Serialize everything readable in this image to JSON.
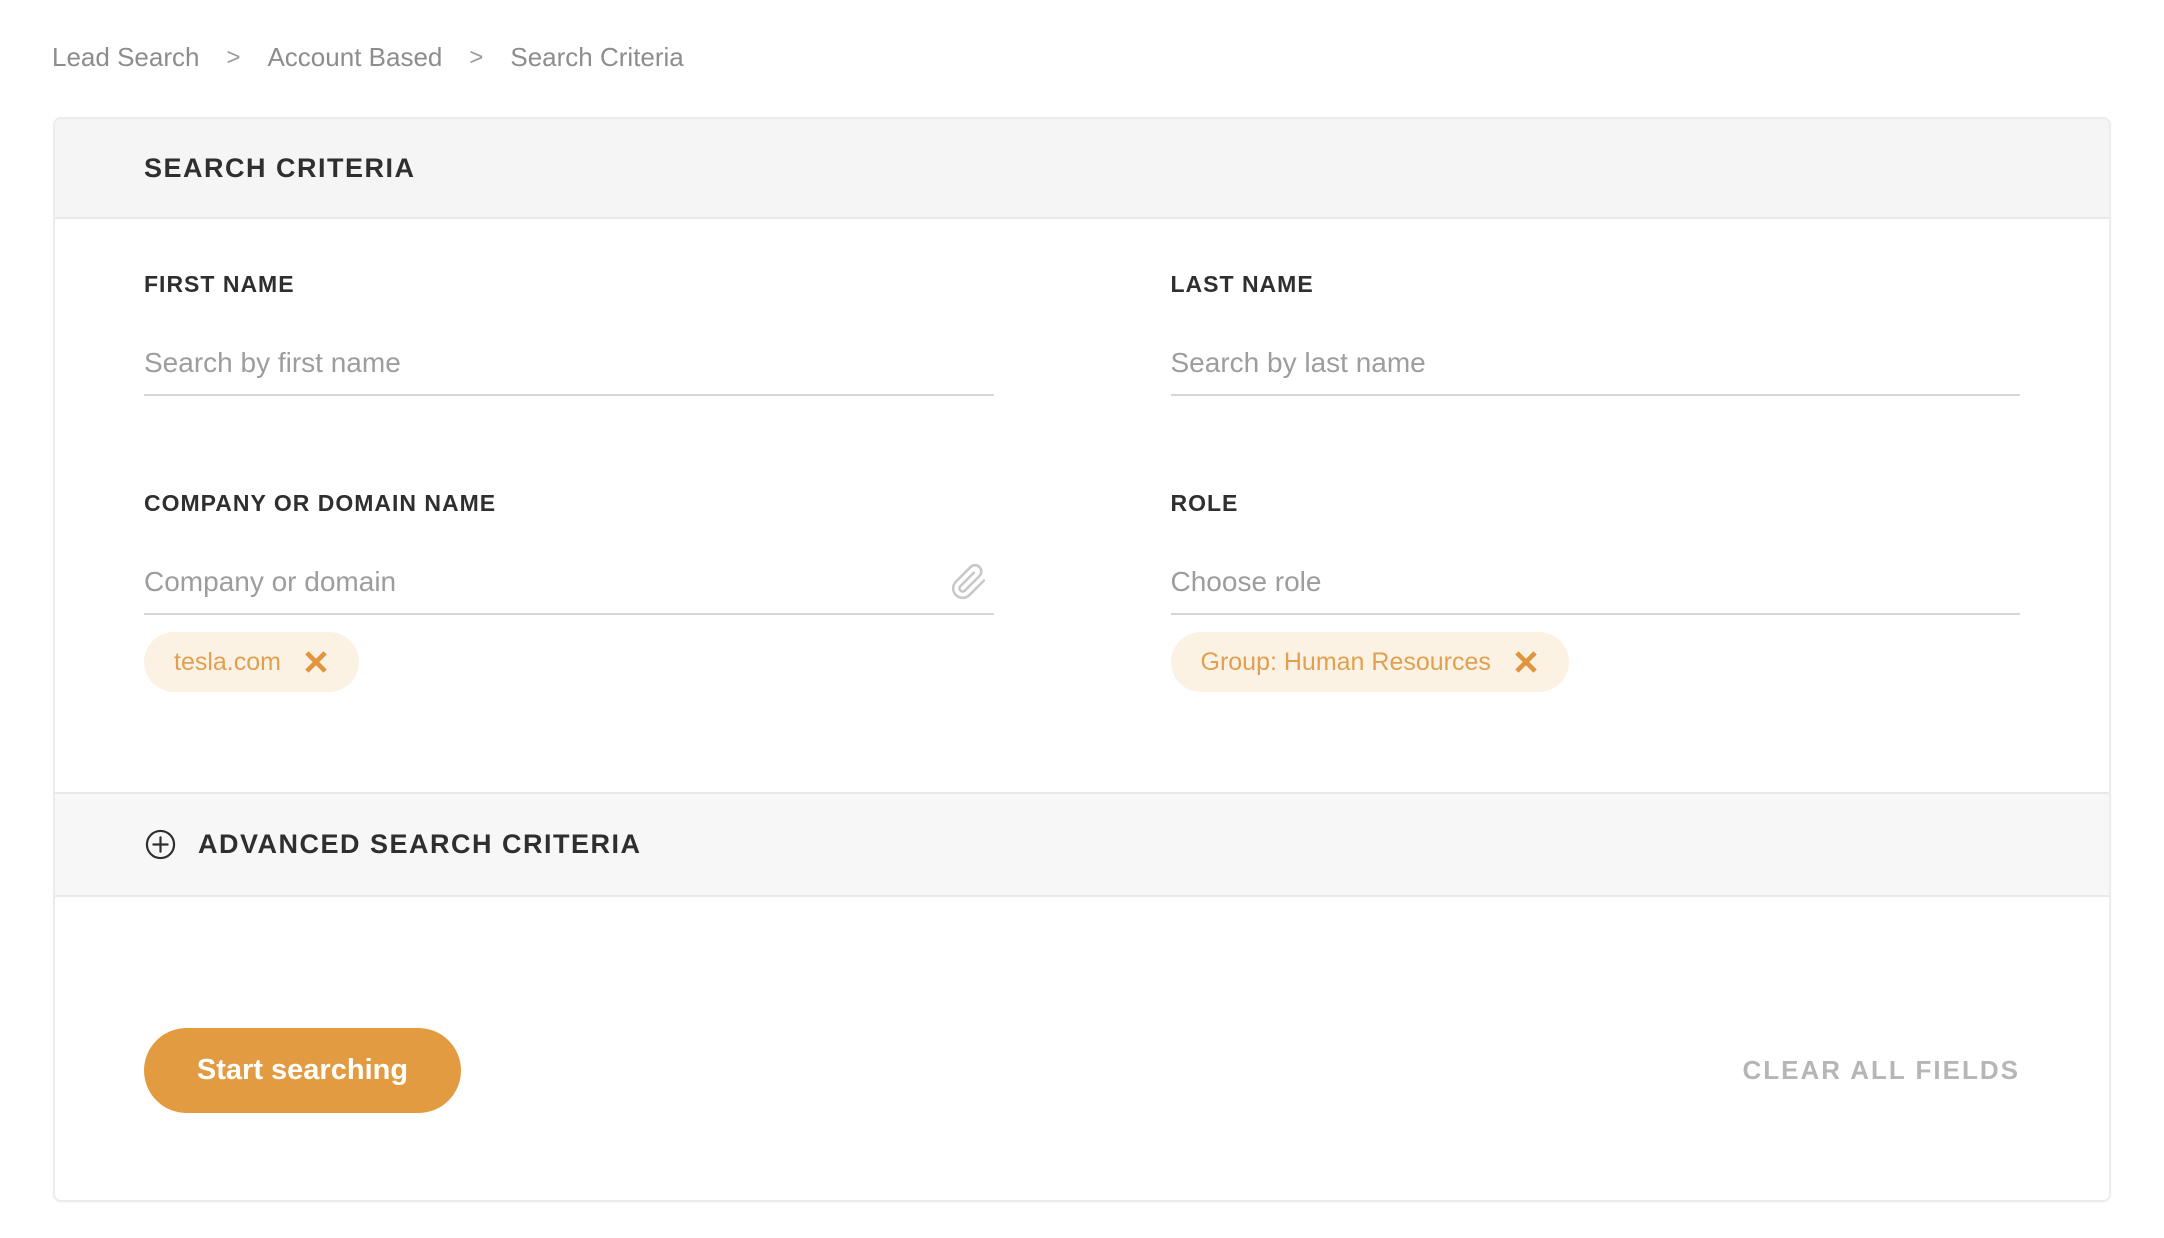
{
  "breadcrumb": {
    "separator": ">",
    "items": [
      "Lead Search",
      "Account Based",
      "Search Criteria"
    ]
  },
  "card": {
    "header_title": "SEARCH CRITERIA",
    "fields": {
      "first_name": {
        "label": "FIRST NAME",
        "placeholder": "Search by first name",
        "value": ""
      },
      "last_name": {
        "label": "LAST NAME",
        "placeholder": "Search by last name",
        "value": ""
      },
      "company": {
        "label": "COMPANY OR DOMAIN NAME",
        "placeholder": "Company or domain",
        "value": "",
        "icon": "paperclip-icon",
        "tags": [
          {
            "label": "tesla.com"
          }
        ]
      },
      "role": {
        "label": "ROLE",
        "placeholder": "Choose role",
        "value": "",
        "tags": [
          {
            "label": "Group: Human Resources"
          }
        ]
      }
    },
    "advanced": {
      "icon": "circle-plus-icon",
      "label": "ADVANCED SEARCH CRITERIA"
    },
    "footer": {
      "search_label": "Start searching",
      "clear_label": "CLEAR ALL FIELDS"
    }
  },
  "colors": {
    "accent_orange": "#e29b41",
    "tag_background": "#fcf2e4",
    "tag_text": "#e0a050",
    "tag_close": "#e0953e",
    "header_strip": "#f5f5f5",
    "advanced_strip": "#f7f7f7",
    "underline": "#d6d6d6",
    "label_text": "#2f2f2f",
    "muted_text": "#9d9d9d"
  }
}
